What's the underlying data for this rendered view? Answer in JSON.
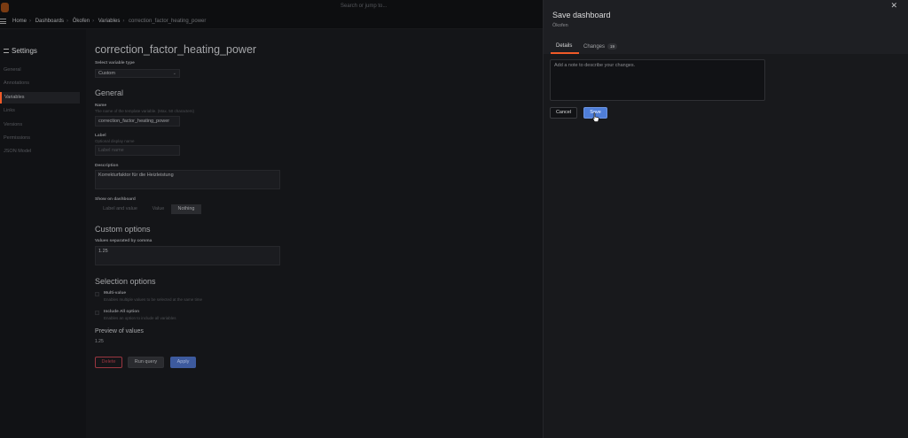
{
  "topbar": {
    "search_placeholder": "Search or jump to..."
  },
  "breadcrumb": {
    "items": [
      "Home",
      "Dashboards",
      "Ökofen",
      "Variables",
      "correction_factor_heating_power"
    ],
    "separator": "›"
  },
  "sidebar": {
    "title": "Settings",
    "items": [
      {
        "label": "General"
      },
      {
        "label": "Annotations"
      },
      {
        "label": "Variables"
      },
      {
        "label": "Links"
      },
      {
        "label": "Versions"
      },
      {
        "label": "Permissions"
      },
      {
        "label": "JSON Model"
      }
    ]
  },
  "variable": {
    "heading": "correction_factor_heating_power",
    "type_label": "Select variable type",
    "type_value": "Custom",
    "general_heading": "General",
    "name_label": "Name",
    "name_hint": "The name of the template variable. (Max. 50 characters)",
    "name_value": "correction_factor_heating_power",
    "label_label": "Label",
    "label_hint": "Optional display name",
    "label_placeholder": "Label name",
    "description_label": "Description",
    "description_value": "Korrekturfaktor für die Heizleistung",
    "show_label": "Show on dashboard",
    "show_options": [
      "Label and value",
      "Value",
      "Nothing"
    ],
    "show_selected": "Nothing",
    "custom_heading": "Custom options",
    "values_label": "Values separated by comma",
    "values_value": "1.25",
    "selection_heading": "Selection options",
    "multi_label": "Multi-value",
    "multi_hint": "Enables multiple values to be selected at the same time",
    "include_all_label": "Include All option",
    "include_all_hint": "Enables an option to include all variables",
    "preview_heading": "Preview of values",
    "preview_value": "1.25",
    "delete_label": "Delete",
    "run_query_label": "Run query",
    "apply_label": "Apply"
  },
  "drawer": {
    "title": "Save dashboard",
    "subtitle": "Ökofen",
    "close_glyph": "✕",
    "tab_details": "Details",
    "tab_changes": "Changes",
    "changes_count": "19",
    "note_placeholder": "Add a note to describe your changes.",
    "cancel_label": "Cancel",
    "save_label": "Save"
  },
  "colors": {
    "accent": "#f05a28",
    "primary": "#4f7ed8",
    "danger": "#9a3640"
  }
}
